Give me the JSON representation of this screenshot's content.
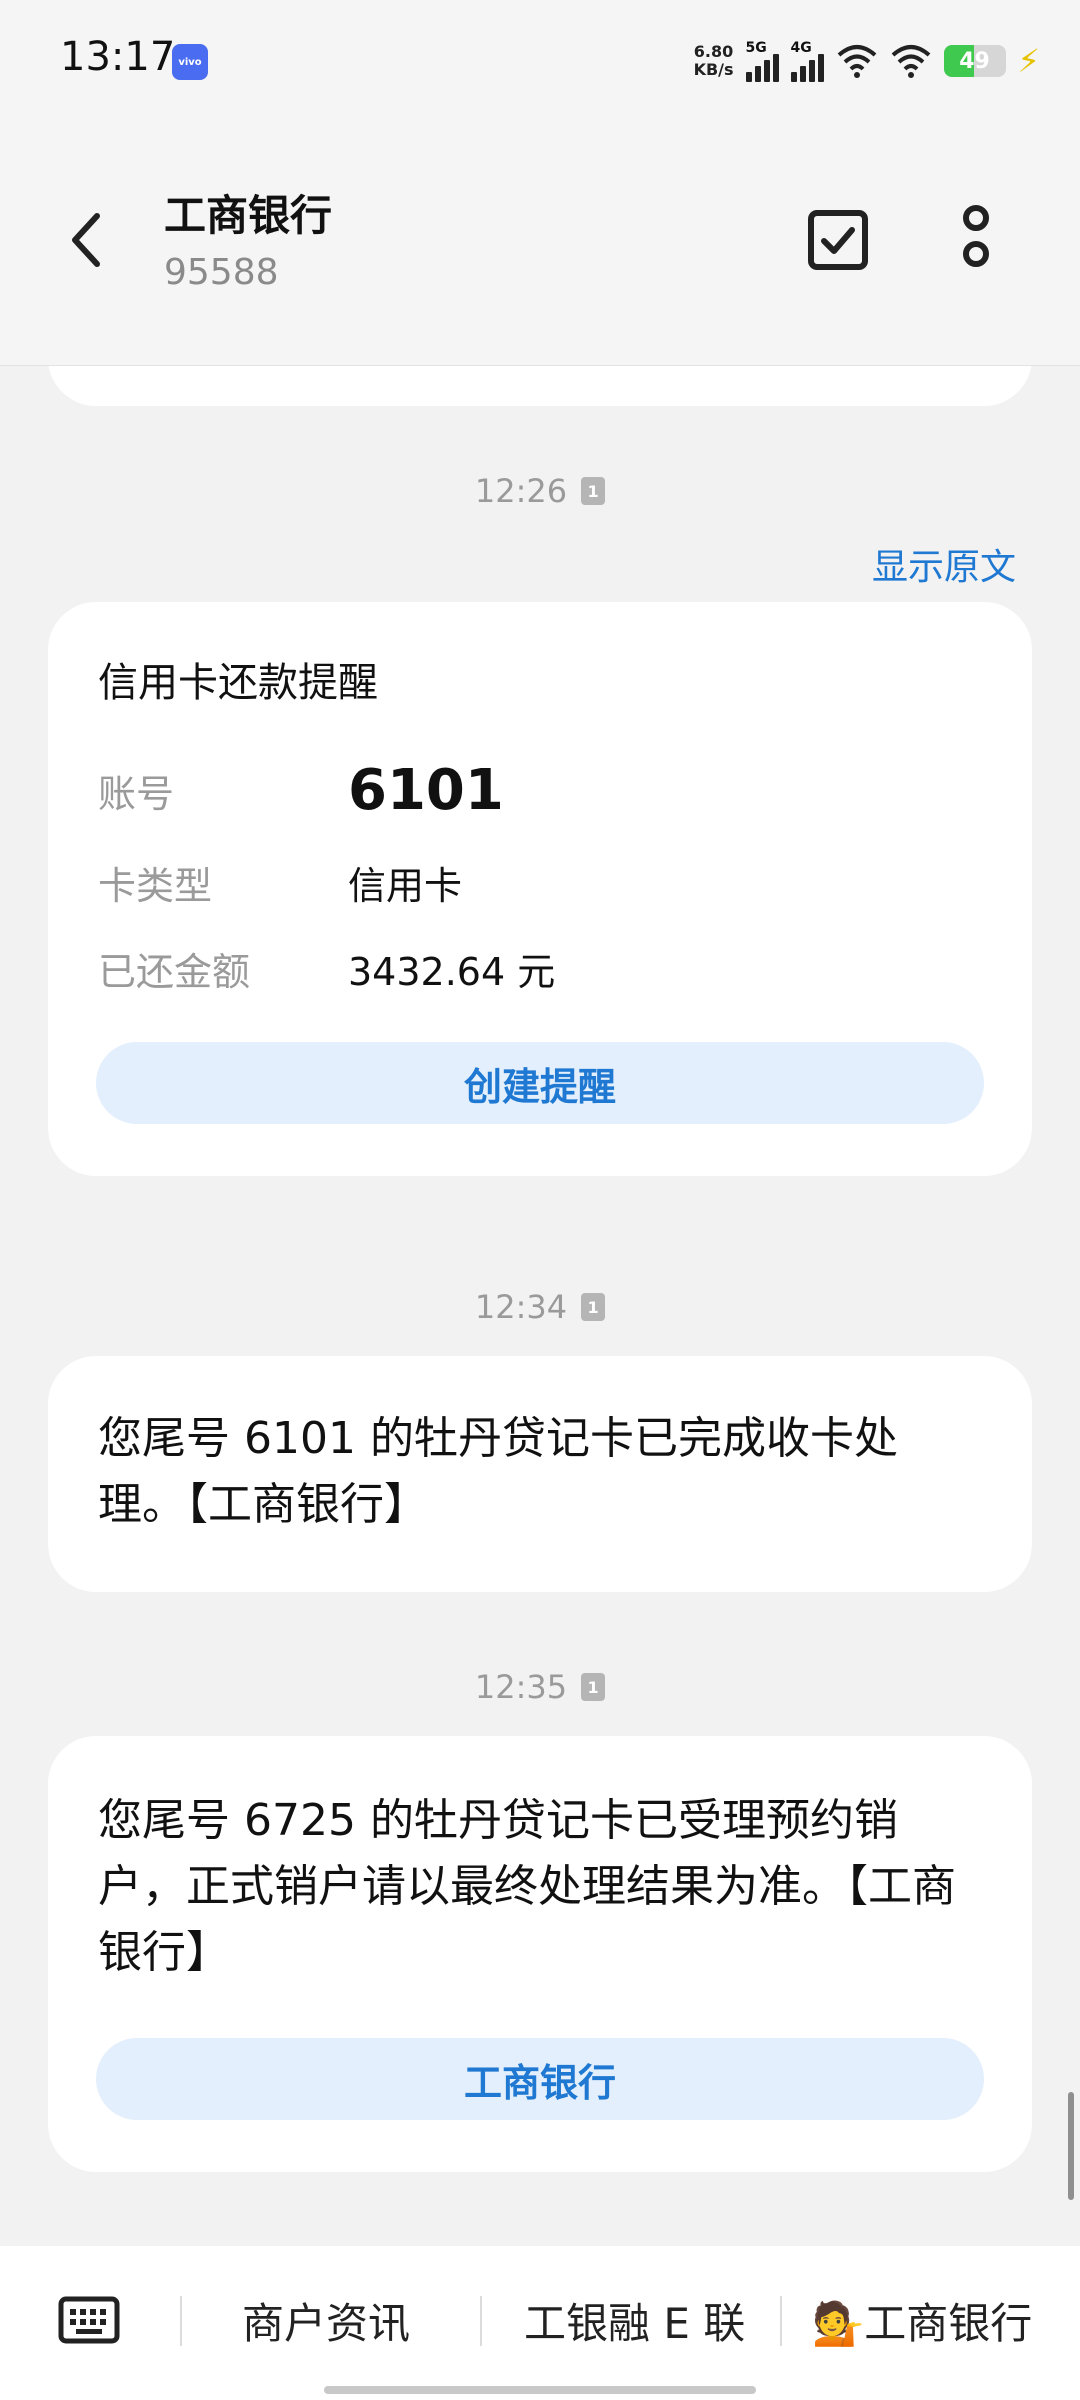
{
  "status_bar": {
    "time": "13:17",
    "app_badge": "vivo",
    "speed_value": "6.80",
    "speed_unit": "KB/s",
    "net1": "5G",
    "net2": "4G",
    "battery": "49",
    "battery_level": 0.49,
    "colors": {
      "battery_fill": "#3fc94e",
      "bolt": "#e6c200"
    }
  },
  "header": {
    "title": "工商银行",
    "subtitle": "95588",
    "back_icon": "chevron-left-icon",
    "check_icon": "checkbox-icon",
    "more_icon": "more-vertical-icon"
  },
  "messages": [
    {
      "time": "12:26",
      "sim": "1",
      "show_original": "显示原文",
      "card_title": "信用卡还款提醒",
      "fields": [
        {
          "label": "账号",
          "value": "6101"
        },
        {
          "label": "卡类型",
          "value": "信用卡"
        },
        {
          "label": "已还金额",
          "value": "3432.64 元"
        }
      ],
      "action": "创建提醒"
    },
    {
      "time": "12:34",
      "sim": "1",
      "text": "您尾号 6101 的牡丹贷记卡已完成收卡处理。【工商银行】"
    },
    {
      "time": "12:35",
      "sim": "1",
      "text": "您尾号 6725 的牡丹贷记卡已受理预约销户，正式销户请以最终处理结果为准。【工商银行】",
      "action": "工商银行"
    }
  ],
  "bottom_bar": {
    "keyboard_icon": "keyboard-icon",
    "menu": [
      "商户资讯",
      "工银融 E 联",
      "💁工商银行"
    ]
  },
  "colors": {
    "accent": "#1f78d1",
    "pill_bg": "#e3effc",
    "background": "#f2f2f2",
    "card": "#ffffff"
  }
}
